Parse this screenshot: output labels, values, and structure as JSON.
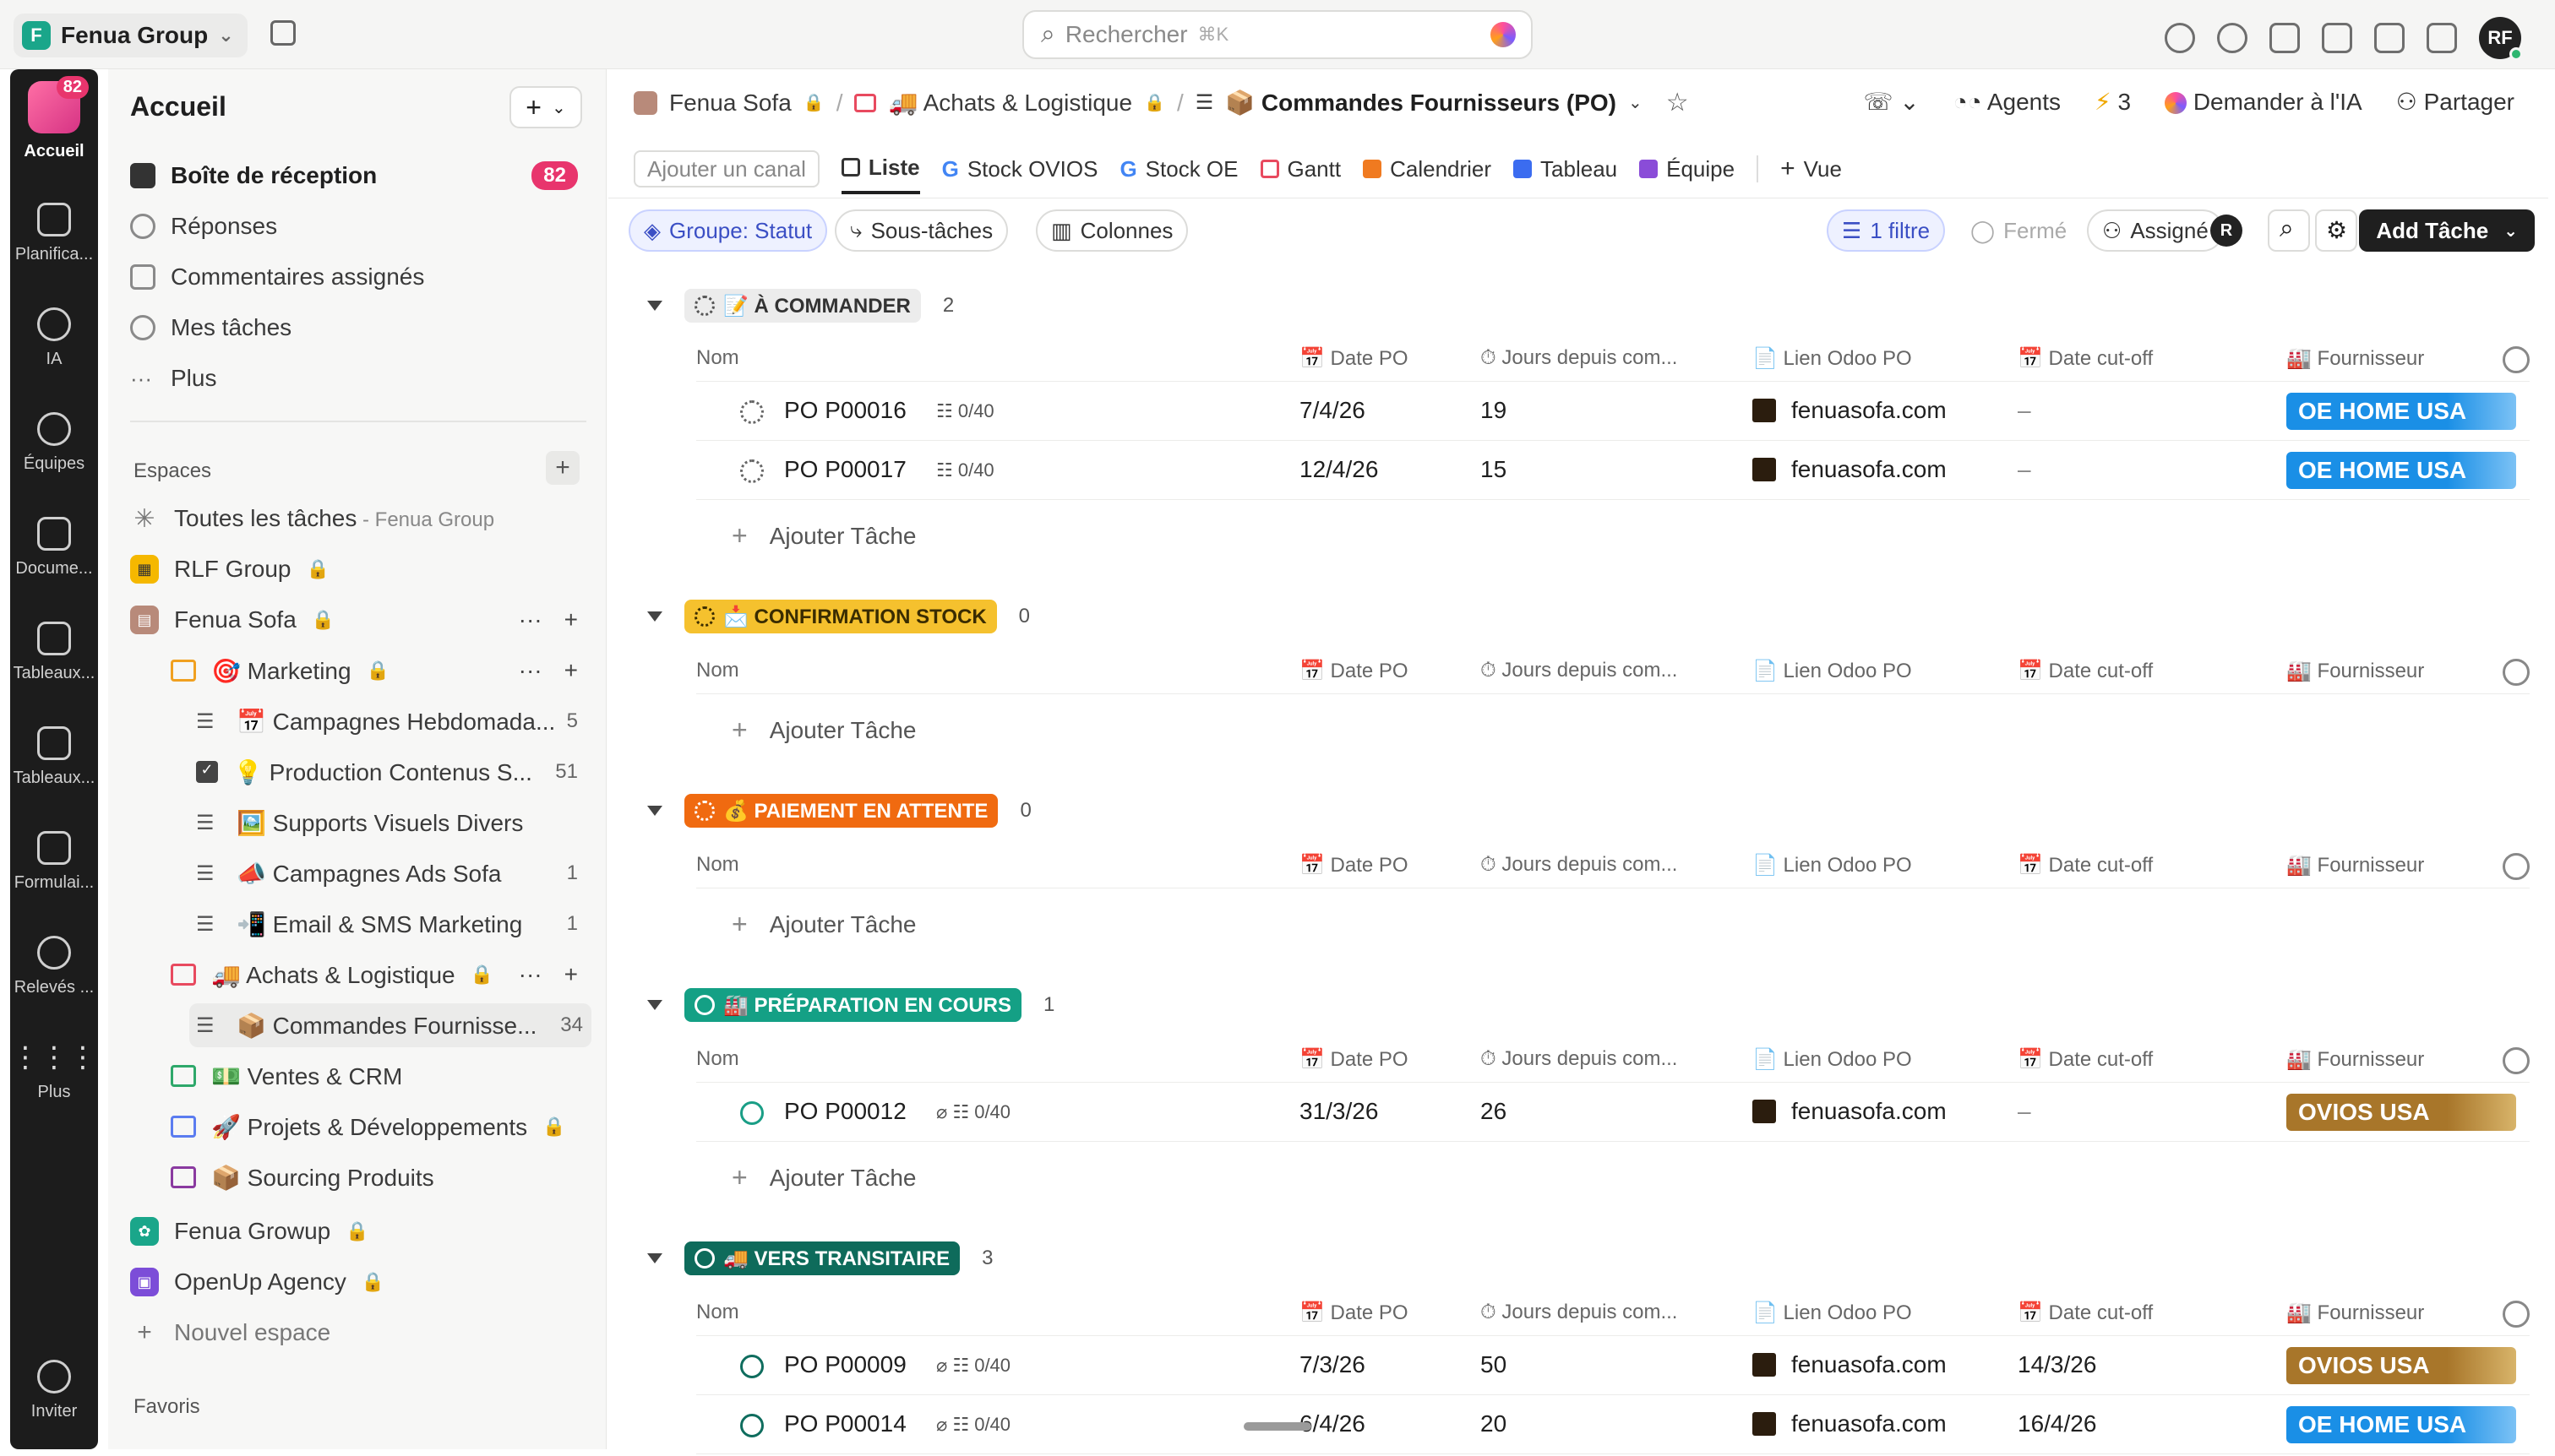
{
  "topbar": {
    "workspace": "Fenua Group",
    "workspace_initial": "F",
    "search_placeholder": "Rechercher",
    "search_shortcut": "⌘K",
    "avatar_initials": "RF"
  },
  "rail": {
    "badge": "82",
    "items": [
      "Accueil",
      "Planifica...",
      "IA",
      "Équipes",
      "Docume...",
      "Tableaux...",
      "Tableaux...",
      "Formulai...",
      "Relevés ...",
      "Plus",
      "Inviter"
    ]
  },
  "sidebar": {
    "title": "Accueil",
    "nav": [
      {
        "label": "Boîte de réception",
        "badge": "82"
      },
      {
        "label": "Réponses"
      },
      {
        "label": "Commentaires assignés"
      },
      {
        "label": "Mes tâches"
      },
      {
        "label": "Plus"
      }
    ],
    "spaces_label": "Espaces",
    "all_tasks": "Toutes les tâches",
    "all_tasks_suffix": " - Fenua Group",
    "spaces": {
      "rlf": "RLF Group",
      "fenua_sofa": "Fenua Sofa",
      "marketing": "🎯 Marketing",
      "lists": [
        {
          "label": "📅 Campagnes Hebdomada...",
          "count": "5"
        },
        {
          "label": "💡 Production Contenus S...",
          "count": "51"
        },
        {
          "label": "🖼️ Supports Visuels Divers",
          "count": ""
        },
        {
          "label": "📣 Campagnes Ads Sofa",
          "count": "1"
        },
        {
          "label": "📲 Email & SMS Marketing",
          "count": "1"
        }
      ],
      "achats": "🚚 Achats & Logistique",
      "commandes": "📦 Commandes Fournisse...",
      "commandes_count": "34",
      "ventes": "💵 Ventes & CRM",
      "projets": "🚀 Projets & Développements",
      "sourcing": "📦 Sourcing Produits",
      "growup": "Fenua Growup",
      "openup": "OpenUp Agency",
      "new_space": "Nouvel espace",
      "favoris": "Favoris"
    }
  },
  "main": {
    "crumbs": [
      "Fenua Sofa",
      "🚚 Achats & Logistique",
      "📦 Commandes Fournisseurs (PO)"
    ],
    "header_right": {
      "agents": "Agents",
      "bolt_count": "3",
      "ask_ai": "Demander à l'IA",
      "share": "Partager"
    },
    "add_channel": "Ajouter un canal",
    "tabs": [
      "Liste",
      "Stock OVIOS",
      "Stock OE",
      "Gantt",
      "Calendrier",
      "Tableau",
      "Équipe",
      "Vue"
    ],
    "toolbar": {
      "group": "Groupe: Statut",
      "subtasks": "Sous-tâches",
      "columns": "Colonnes",
      "filter": "1 filtre",
      "closed": "Fermé",
      "assigned": "Assigné",
      "assignee_initial": "R",
      "add_task": "Add Tâche"
    },
    "columns": [
      "Nom",
      "📅 Date PO",
      "⏱ Jours depuis com...",
      "📄 Lien Odoo PO",
      "📅 Date cut-off",
      "🏭 Fournisseur"
    ],
    "add_task_row": "Ajouter Tâche",
    "groups": [
      {
        "label": "📝 À COMMANDER",
        "count": "2",
        "bg": "#ececec",
        "fg": "#333333"
      },
      {
        "label": "📩 CONFIRMATION STOCK",
        "count": "0",
        "bg": "#f5c12e",
        "fg": "#3a2c00"
      },
      {
        "label": "💰 PAIEMENT EN ATTENTE",
        "count": "0",
        "bg": "#f06a10",
        "fg": "#ffffff"
      },
      {
        "label": "🏭 PRÉPARATION EN COURS",
        "count": "1",
        "bg": "#14a085",
        "fg": "#ffffff"
      },
      {
        "label": "🚚 VERS TRANSITAIRE",
        "count": "3",
        "bg": "#0e6b5b",
        "fg": "#ffffff"
      }
    ],
    "rows": {
      "r1": {
        "name": "PO P00016",
        "sub": "0/40",
        "date": "7/4/26",
        "days": "19",
        "link": "fenuasofa.com",
        "cutoff": "–",
        "supplier": "OE HOME USA"
      },
      "r2": {
        "name": "PO P00017",
        "sub": "0/40",
        "date": "12/4/26",
        "days": "15",
        "link": "fenuasofa.com",
        "cutoff": "–",
        "supplier": "OE HOME USA"
      },
      "r3": {
        "name": "PO P00012",
        "sub": "0/40",
        "date": "31/3/26",
        "days": "26",
        "link": "fenuasofa.com",
        "cutoff": "–",
        "supplier": "OVIOS USA"
      },
      "r4": {
        "name": "PO P00009",
        "sub": "0/40",
        "date": "7/3/26",
        "days": "50",
        "link": "fenuasofa.com",
        "cutoff": "14/3/26",
        "supplier": "OVIOS USA"
      },
      "r5": {
        "name": "PO P00014",
        "sub": "0/40",
        "date": "6/4/26",
        "days": "20",
        "link": "fenuasofa.com",
        "cutoff": "16/4/26",
        "supplier": "OE HOME USA"
      }
    }
  }
}
